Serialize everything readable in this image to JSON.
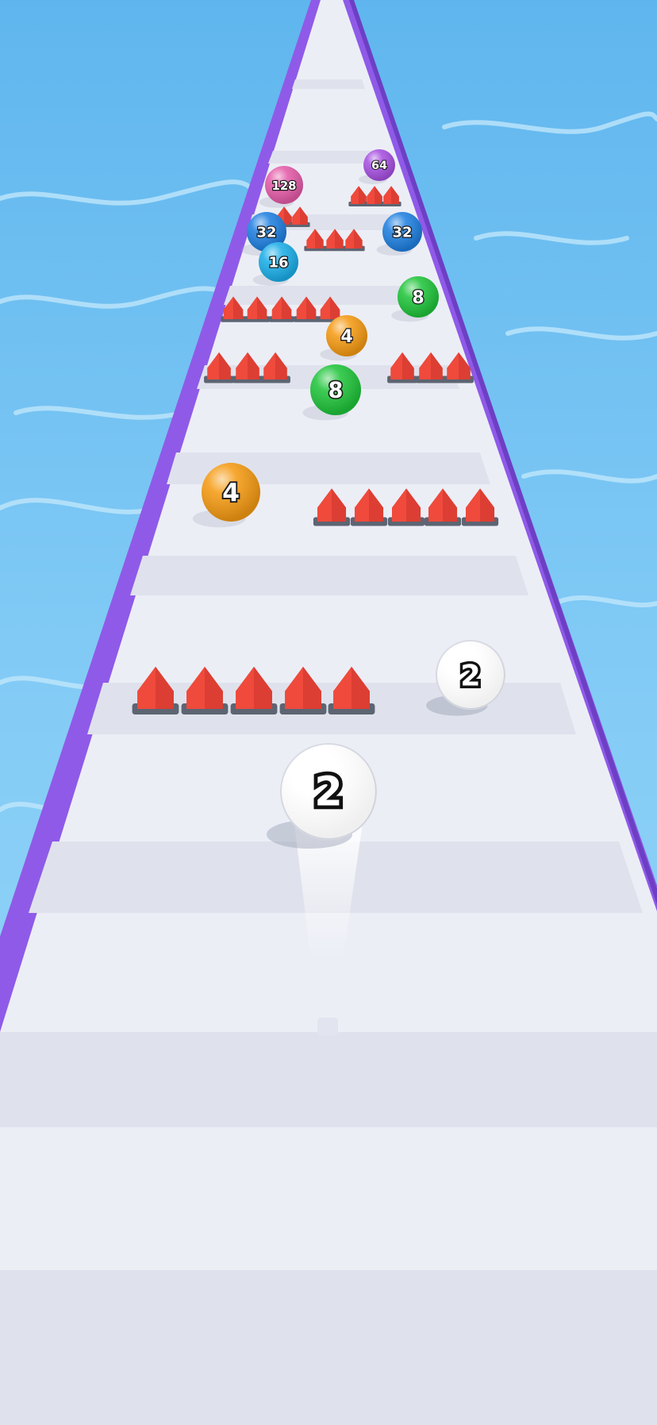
{
  "game": {
    "player_ball": {
      "value": "2",
      "color": "#ffffff"
    },
    "balls": [
      {
        "id": "ball-64",
        "value": "64",
        "color": "#a64fe0"
      },
      {
        "id": "ball-128",
        "value": "128",
        "color": "#e45aa8"
      },
      {
        "id": "ball-32-left",
        "value": "32",
        "color": "#1e7fe0"
      },
      {
        "id": "ball-32-right",
        "value": "32",
        "color": "#1e7fe0"
      },
      {
        "id": "ball-16",
        "value": "16",
        "color": "#1aaee8"
      },
      {
        "id": "ball-8-upper",
        "value": "8",
        "color": "#1fc43a"
      },
      {
        "id": "ball-4-upper",
        "value": "4",
        "color": "#f59a12"
      },
      {
        "id": "ball-8-lower",
        "value": "8",
        "color": "#1fc43a"
      },
      {
        "id": "ball-4-lower",
        "value": "4",
        "color": "#f59a12"
      },
      {
        "id": "ball-2-side",
        "value": "2",
        "color": "#ffffff"
      }
    ],
    "colors": {
      "water": "#7ec9f5",
      "track": "#eceef6",
      "track_stripe": "#dfe2ec",
      "rail": "#8f5ae8",
      "spike": "#ef4a3c",
      "spike_base": "#5d6472"
    }
  }
}
